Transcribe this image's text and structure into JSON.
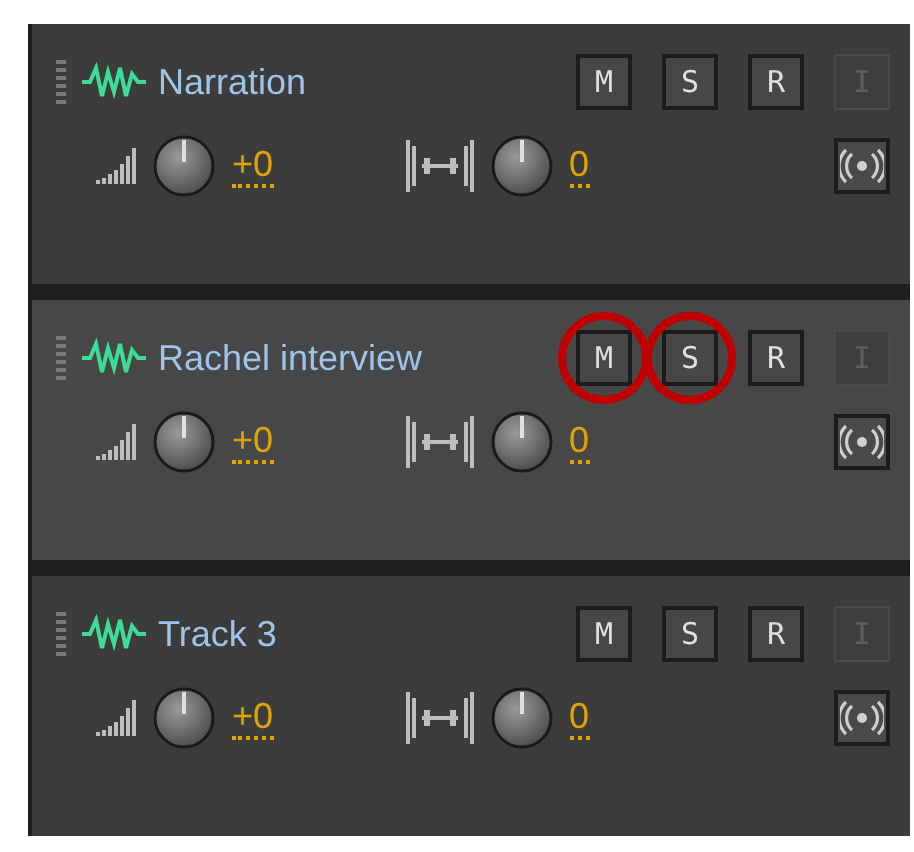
{
  "tracks": [
    {
      "name": "Narration",
      "selected": false,
      "buttons": [
        {
          "label": "M",
          "disabled": false,
          "circled": false
        },
        {
          "label": "S",
          "disabled": false,
          "circled": false
        },
        {
          "label": "R",
          "disabled": false,
          "circled": false
        },
        {
          "label": "I",
          "disabled": true,
          "circled": false
        }
      ],
      "volume": "+0",
      "pan": "0"
    },
    {
      "name": "Rachel interview",
      "selected": true,
      "buttons": [
        {
          "label": "M",
          "disabled": false,
          "circled": true
        },
        {
          "label": "S",
          "disabled": false,
          "circled": true
        },
        {
          "label": "R",
          "disabled": false,
          "circled": false
        },
        {
          "label": "I",
          "disabled": true,
          "circled": false
        }
      ],
      "volume": "+0",
      "pan": "0"
    },
    {
      "name": "Track 3",
      "selected": false,
      "buttons": [
        {
          "label": "M",
          "disabled": false,
          "circled": false
        },
        {
          "label": "S",
          "disabled": false,
          "circled": false
        },
        {
          "label": "R",
          "disabled": false,
          "circled": false
        },
        {
          "label": "I",
          "disabled": true,
          "circled": false
        }
      ],
      "volume": "+0",
      "pan": "0"
    }
  ]
}
